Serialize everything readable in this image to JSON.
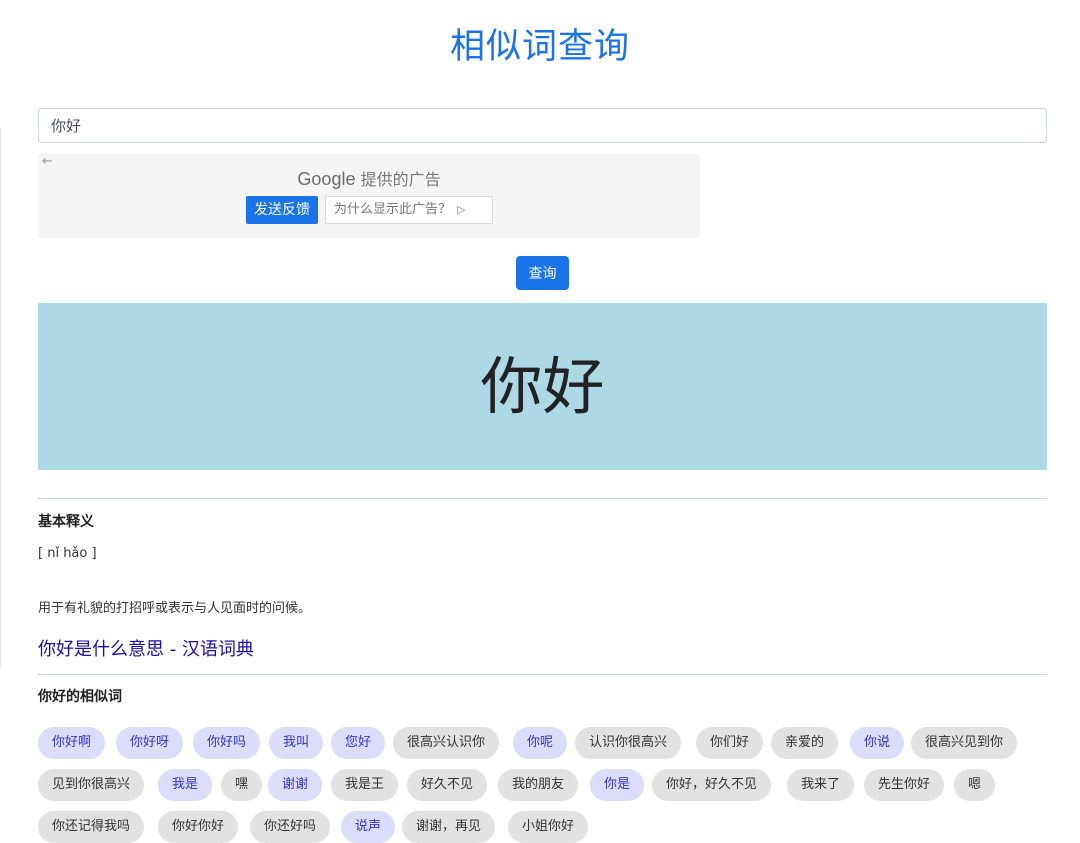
{
  "page": {
    "title": "相似词查询"
  },
  "search": {
    "value": "你好"
  },
  "ad": {
    "back_icon": "←",
    "brand": "Google",
    "brand_suffix": "提供的广告",
    "feedback_label": "发送反馈",
    "why_label": "为什么显示此广告？",
    "why_icon": "▷"
  },
  "query_button": "查询",
  "hero": {
    "word": "你好"
  },
  "definition": {
    "heading": "基本释义",
    "pinyin": "[ nǐ hǎo ]",
    "text": "用于有礼貌的打招呼或表示与人见面时的问候。",
    "link": "你好是什么意思 - 汉语词典"
  },
  "related": {
    "heading": "你好的相似词",
    "tags": [
      {
        "label": "你好啊",
        "link": true
      },
      {
        "label": "你好呀",
        "link": true
      },
      {
        "label": "你好吗",
        "link": true
      },
      {
        "label": "我叫",
        "link": true
      },
      {
        "label": "您好",
        "link": true
      },
      {
        "label": "很高兴认识你",
        "link": false
      },
      {
        "label": "你呢",
        "link": true
      },
      {
        "label": "认识你很高兴",
        "link": false
      },
      {
        "label": "你们好",
        "link": false
      },
      {
        "label": "亲爱的",
        "link": false
      },
      {
        "label": "你说",
        "link": true
      },
      {
        "label": "很高兴见到你",
        "link": false
      },
      {
        "label": "见到你很高兴",
        "link": false
      },
      {
        "label": "我是",
        "link": true
      },
      {
        "label": "嘿",
        "link": false
      },
      {
        "label": "谢谢",
        "link": true
      },
      {
        "label": "我是王",
        "link": false
      },
      {
        "label": "好久不见",
        "link": false
      },
      {
        "label": "我的朋友",
        "link": false
      },
      {
        "label": "你是",
        "link": true
      },
      {
        "label": "你好，好久不见",
        "link": false
      },
      {
        "label": "我来了",
        "link": false
      },
      {
        "label": "先生你好",
        "link": false
      },
      {
        "label": "嗯",
        "link": false
      },
      {
        "label": "你还记得我吗",
        "link": false
      },
      {
        "label": "你好你好",
        "link": false
      },
      {
        "label": "你还好吗",
        "link": false
      },
      {
        "label": "说声",
        "link": true
      },
      {
        "label": "谢谢，再见",
        "link": false
      },
      {
        "label": "小姐你好",
        "link": false
      }
    ]
  }
}
